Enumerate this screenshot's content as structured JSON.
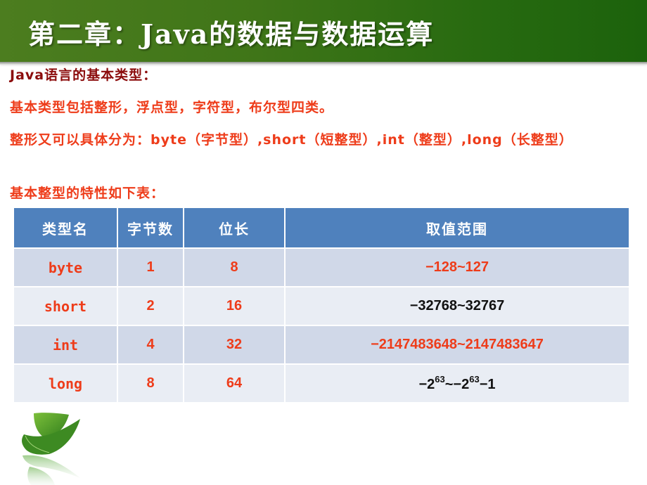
{
  "header": {
    "title": "第二章：Java的数据与数据运算"
  },
  "content": {
    "heading": "Java语言的基本类型：",
    "line1": "基本类型包括整形，浮点型，字符型，布尔型四类。",
    "line2": "整形又可以具体分为：byte（字节型）,short（短整型）,int（整型）,long（长整型）",
    "line3": "基本整型的特性如下表："
  },
  "table": {
    "headers": [
      "类型名",
      "字节数",
      "位长",
      "取值范围"
    ],
    "rows": [
      {
        "name": "byte",
        "bytes": "1",
        "bits": "8",
        "range": {
          "pre": "−128~127",
          "sup1": "",
          "mid": "",
          "sup2": "",
          "post": ""
        },
        "range_color": "red"
      },
      {
        "name": "short",
        "bytes": "2",
        "bits": "16",
        "range": {
          "pre": "−32768~32767",
          "sup1": "",
          "mid": "",
          "sup2": "",
          "post": ""
        },
        "range_color": "black"
      },
      {
        "name": "int",
        "bytes": "4",
        "bits": "32",
        "range": {
          "pre": "−2147483648~2147483647",
          "sup1": "",
          "mid": "",
          "sup2": "",
          "post": ""
        },
        "range_color": "red"
      },
      {
        "name": "long",
        "bytes": "8",
        "bits": "64",
        "range": {
          "pre": "−2",
          "sup1": "63",
          "mid": "~−2",
          "sup2": "63",
          "post": "−1"
        },
        "range_color": "black"
      }
    ]
  },
  "colors": {
    "header_green": "#3f7518",
    "heading_dark_red": "#8b0b0b",
    "text_red": "#ee3c1a",
    "table_header_blue": "#4f81bd",
    "row_odd": "#d0d8e8",
    "row_even": "#e9edf4"
  },
  "decoration": {
    "icon": "green-leaf-icon"
  }
}
